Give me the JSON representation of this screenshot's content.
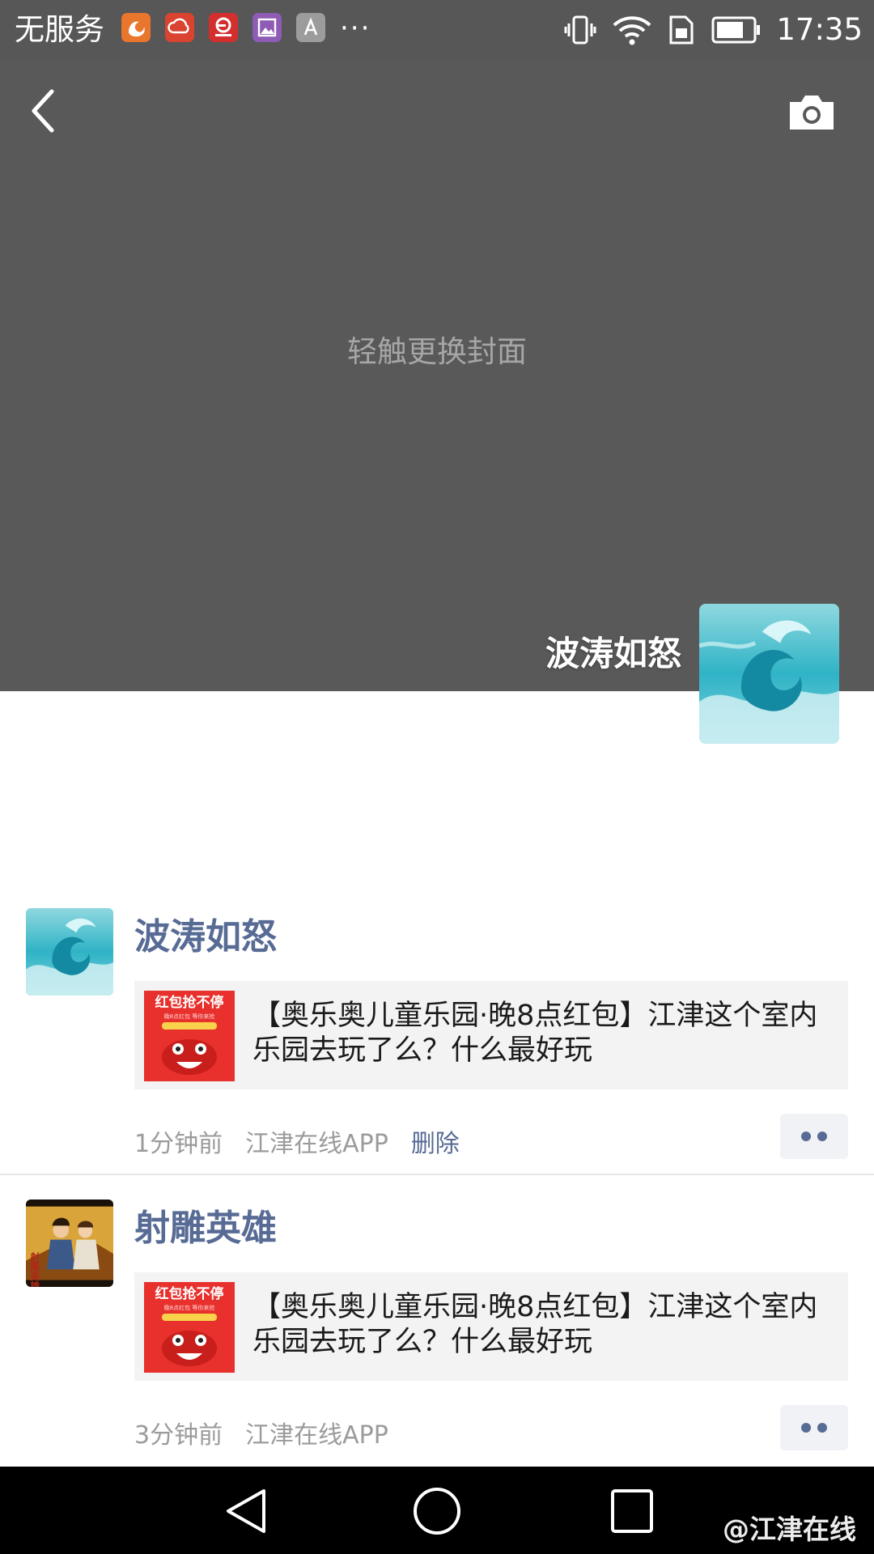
{
  "status_bar": {
    "carrier": "无服务",
    "more_indicator": "···",
    "time": "17:35",
    "app_icons": [
      "uc-browser-icon",
      "cloud-app-icon",
      "jiangjin-online-icon",
      "gallery-icon",
      "font-app-icon"
    ],
    "system_icons": [
      "vibrate-icon",
      "wifi-icon",
      "sim-icon",
      "battery-icon"
    ]
  },
  "cover": {
    "hint": "轻触更换封面",
    "profile_name": "波涛如怒",
    "back_icon": "back-arrow-icon",
    "camera_icon": "camera-icon",
    "background_color": "#595959"
  },
  "posts": [
    {
      "author": "波涛如怒",
      "share_title": "【奥乐奥儿童乐园·晚8点红包】江津这个室内乐园去玩了么？什么最好玩",
      "time": "1分钟前",
      "source": "江津在线APP",
      "delete_label": "删除"
    },
    {
      "author": "射雕英雄",
      "share_title": "【奥乐奥儿童乐园·晚8点红包】江津这个室内乐园去玩了么？什么最好玩",
      "time": "3分钟前",
      "source": "江津在线APP"
    }
  ],
  "thumb_text": {
    "banner": "红包抢不停",
    "small_line": "晚8点红包 等你来抢",
    "poster_title": "射雕英雄传"
  },
  "nav_bar": {
    "buttons": [
      "nav-back-icon",
      "nav-home-icon",
      "nav-recents-icon"
    ]
  },
  "watermark": "@江津在线",
  "colors": {
    "name_link": "#576b95",
    "meta_gray": "#9b9b9b",
    "card_bg": "#f3f3f3"
  }
}
